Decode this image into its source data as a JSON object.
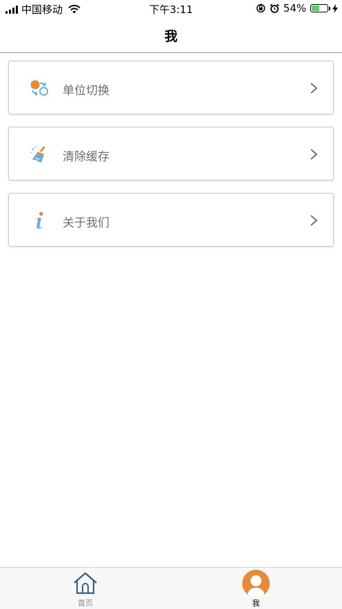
{
  "status_bar": {
    "carrier": "中国移动",
    "time": "下午3:11",
    "battery_percent": "54%",
    "battery_level": 0.54,
    "icons": [
      "signal-icon",
      "wifi-icon",
      "orientation-lock-icon",
      "alarm-icon",
      "battery-icon",
      "charging-icon"
    ]
  },
  "nav": {
    "title": "我"
  },
  "menu": {
    "items": [
      {
        "label": "单位切换",
        "icon": "unit-switch-icon"
      },
      {
        "label": "清除缓存",
        "icon": "clear-cache-broom-icon"
      },
      {
        "label": "关于我们",
        "icon": "info-icon"
      }
    ]
  },
  "tabbar": {
    "tabs": [
      {
        "label": "首页",
        "icon": "home-icon",
        "active": false
      },
      {
        "label": "我",
        "icon": "user-icon",
        "active": true
      }
    ]
  },
  "colors": {
    "accent": "#e8893a",
    "icon_blue": "#6aaee0",
    "label_gray": "#6e6e6e",
    "battery_green": "#4cd964"
  }
}
